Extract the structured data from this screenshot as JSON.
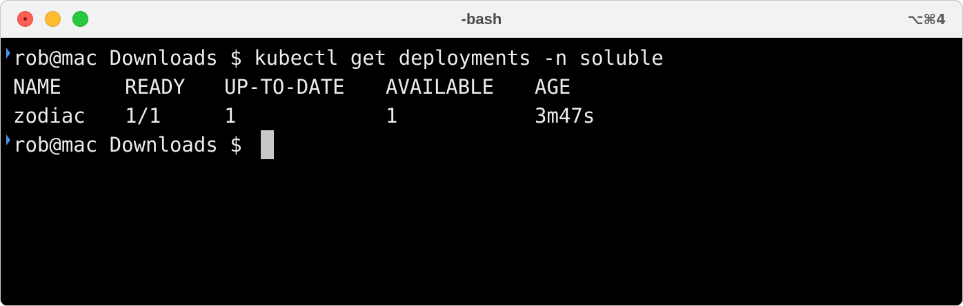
{
  "window": {
    "title": "-bash",
    "shortcut": "⌥⌘4"
  },
  "terminal": {
    "command_line": {
      "prompt": "rob@mac Downloads $ ",
      "command": "kubectl get deployments -n soluble"
    },
    "table": {
      "headers": [
        "NAME",
        "READY",
        "UP-TO-DATE",
        "AVAILABLE",
        "AGE"
      ],
      "rows": [
        [
          "zodiac",
          "1/1",
          "1",
          "1",
          "3m47s"
        ]
      ]
    },
    "current_prompt": "rob@mac Downloads $ ",
    "marker_color": "#4a90e2",
    "text_color": "#ececec",
    "background_color": "#000000"
  }
}
